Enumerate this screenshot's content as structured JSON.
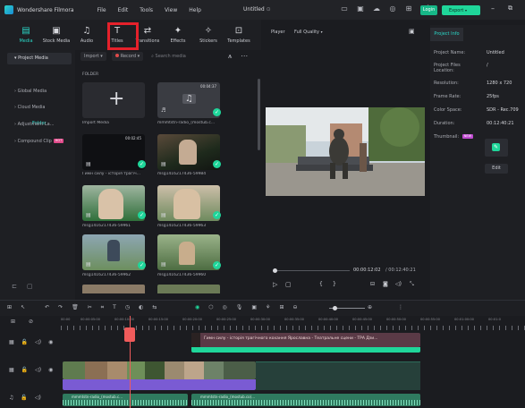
{
  "window": {
    "app_name": "Wondershare Filmora",
    "menu": [
      "File",
      "Edit",
      "Tools",
      "View",
      "Help"
    ],
    "document": "Untitled",
    "login": "Login",
    "export": "Export"
  },
  "media_tabs": [
    {
      "label": "Media",
      "icon": "media-icon",
      "active": true
    },
    {
      "label": "Stock Media",
      "icon": "stock-media-icon",
      "active": false
    },
    {
      "label": "Audio",
      "icon": "music-note-icon",
      "active": false
    },
    {
      "label": "Titles",
      "icon": "text-t-icon",
      "active": false
    },
    {
      "label": "Transitions",
      "icon": "transitions-icon",
      "active": false
    },
    {
      "label": "Effects",
      "icon": "effects-icon",
      "active": false
    },
    {
      "label": "Stickers",
      "icon": "stickers-icon",
      "active": false
    },
    {
      "label": "Templates",
      "icon": "templates-icon",
      "active": false
    }
  ],
  "sidebar": {
    "items": [
      {
        "label": "Project Media",
        "active": true
      },
      {
        "label": "Global Media",
        "active": false
      },
      {
        "label": "Cloud Media",
        "active": false
      },
      {
        "label": "Adjustment La...",
        "active": false
      },
      {
        "label": "Compound Clip",
        "active": false,
        "badge": "HOT"
      }
    ],
    "folder": "Folder"
  },
  "library": {
    "toolbar": {
      "import": "Import",
      "record": "Record",
      "search_placeholder": "Search media"
    },
    "folder_header": "FOLDER",
    "items": [
      {
        "label": "Import Media",
        "kind": "import"
      },
      {
        "label": "mmmtstn-radio_(mostub.c...",
        "kind": "audio",
        "duration": "00:04:37"
      },
      {
        "label": "Гимн силу - історія трагіч...",
        "kind": "video",
        "duration": "00:02:45"
      },
      {
        "label": "msg1416217436-59984",
        "kind": "video"
      },
      {
        "label": "msg1416217436-59961",
        "kind": "video"
      },
      {
        "label": "msg1416217436-59963",
        "kind": "video"
      },
      {
        "label": "msg1416217436-59962",
        "kind": "video"
      },
      {
        "label": "msg1416217436-59960",
        "kind": "video"
      }
    ]
  },
  "player": {
    "label": "Player",
    "quality": "Full Quality",
    "current_time": "00:00:12:02",
    "total_time": "/ 00:12:40:21"
  },
  "project_info": {
    "tab": "Project Info",
    "fields": [
      {
        "label": "Project Name:",
        "value": "Untitled"
      },
      {
        "label": "Project Files Location:",
        "value": "/"
      },
      {
        "label": "Resolution:",
        "value": "1280 x 720"
      },
      {
        "label": "Frame Rate:",
        "value": "25fps"
      },
      {
        "label": "Color Space:",
        "value": "SDR - Rec.709"
      },
      {
        "label": "Duration:",
        "value": "00:12:40:21"
      }
    ],
    "thumbnail_label": "Thumbnail:",
    "thumbnail_badge": "NEW",
    "edit_label": "Edit"
  },
  "timeline": {
    "ruler": [
      "00:00",
      "00:00:05:00",
      "00:00:10:00",
      "00:00:15:00",
      "00:00:20:00",
      "00:00:25:00",
      "00:00:30:00",
      "00:00:35:00",
      "00:00:40:00",
      "00:00:45:00",
      "00:00:50:00",
      "00:00:55:00",
      "00:01:00:00",
      "00:01:0"
    ],
    "title_clip": "Гимн силу - історія трагічного кохання Ярославна - Театральне сцени - ТРА Дзи...",
    "audio_clip_1": "mmmtstn-radio_(mostub.c...",
    "audio_clip_2": "mmmtstn-radio_(mostub.co)..."
  },
  "colors": {
    "accent": "#2bd8c8",
    "export": "#1fd69a",
    "highlight": "#e5212b",
    "playhead": "#f05b5b"
  }
}
